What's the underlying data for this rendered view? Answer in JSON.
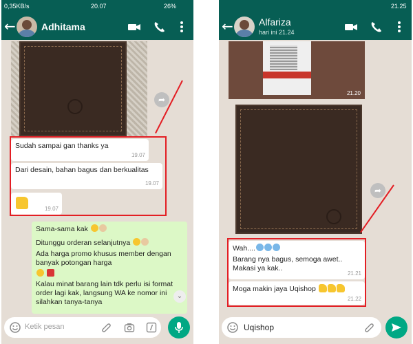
{
  "left_phone": {
    "status": {
      "carrier": "0,35KB/s",
      "time": "20.07",
      "battery": "26%"
    },
    "contact_name": "Adhitama",
    "messages": [
      {
        "text": "Sudah sampai gan thanks ya",
        "time": "19.07"
      },
      {
        "text": "Dari desain, bahan bagus dan berkualitas",
        "time": "19.07"
      },
      {
        "text": "",
        "time": "19.07"
      }
    ],
    "reply_lines": [
      "Sama-sama kak",
      "Ditunggu orderan selanjutnya",
      "Ada harga promo khusus member dengan banyak potongan harga",
      "Kalau minat barang lain tdk perlu isi format order lagi kak, langsung WA ke nomor ini silahkan tanya-tanya"
    ],
    "input_placeholder": "Ketik pesan"
  },
  "right_phone": {
    "status": {
      "time": "21.25"
    },
    "contact_name": "Alfariza",
    "contact_sub": "hari ini 21.24",
    "photo_time": "21.20",
    "messages": [
      {
        "text": "Wah....",
        "time": ""
      },
      {
        "text": "Barang nya bagus, semoga awet.. Makasi ya kak..",
        "time": "21.21"
      },
      {
        "text": "Moga makin jaya Uqishop",
        "time": "21.22"
      }
    ],
    "input_value": "Uqishop"
  },
  "colors": {
    "header": "#075e54",
    "bubble_in": "#ffffff",
    "bubble_out": "#dcf8c6",
    "highlight": "#e31e24",
    "send": "#00a884"
  },
  "icons": [
    "back-arrow-icon",
    "video-call-icon",
    "phone-icon",
    "more-icon",
    "emoji-icon",
    "attach-icon",
    "camera-icon",
    "mic-icon",
    "send-icon",
    "forward-icon"
  ]
}
